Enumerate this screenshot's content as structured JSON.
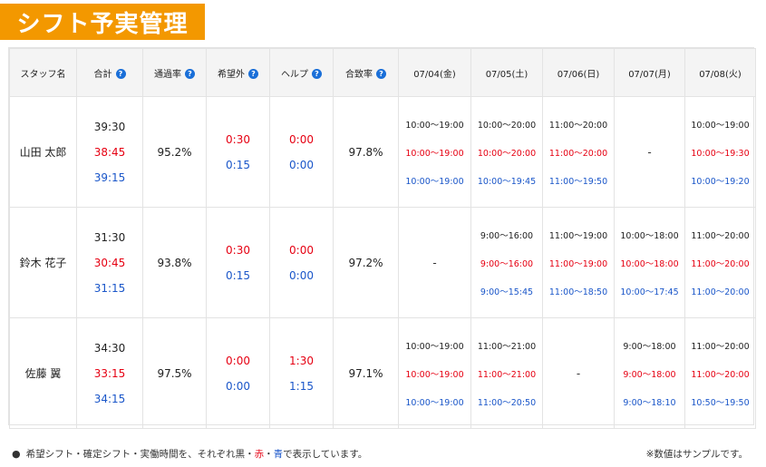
{
  "title": "シフト予実管理",
  "headers": {
    "staff": "スタッフ名",
    "total": "合計",
    "pass_rate": "通過率",
    "unwanted": "希望外",
    "help": "ヘルプ",
    "match_rate": "合致率",
    "dates": [
      "07/04(金)",
      "07/05(土)",
      "07/06(日)",
      "07/07(月)",
      "07/08(火)"
    ],
    "help_mark": "?"
  },
  "rows": [
    {
      "name": "山田 太郎",
      "total": [
        "39:30",
        "38:45",
        "39:15"
      ],
      "pass_rate": "95.2%",
      "unwanted": [
        "0:30",
        "0:15"
      ],
      "help": [
        "0:00",
        "0:00"
      ],
      "match_rate": "97.8%",
      "days": [
        [
          "10:00〜19:00",
          "10:00〜19:00",
          "10:00〜19:00"
        ],
        [
          "10:00〜20:00",
          "10:00〜20:00",
          "10:00〜19:45"
        ],
        [
          "11:00〜20:00",
          "11:00〜20:00",
          "11:00〜19:50"
        ],
        "-",
        [
          "10:00〜19:00",
          "10:00〜19:30",
          "10:00〜19:20"
        ]
      ]
    },
    {
      "name": "鈴木 花子",
      "total": [
        "31:30",
        "30:45",
        "31:15"
      ],
      "pass_rate": "93.8%",
      "unwanted": [
        "0:30",
        "0:15"
      ],
      "help": [
        "0:00",
        "0:00"
      ],
      "match_rate": "97.2%",
      "days": [
        "-",
        [
          "9:00〜16:00",
          "9:00〜16:00",
          "9:00〜15:45"
        ],
        [
          "11:00〜19:00",
          "11:00〜19:00",
          "11:00〜18:50"
        ],
        [
          "10:00〜18:00",
          "10:00〜18:00",
          "10:00〜17:45"
        ],
        [
          "11:00〜20:00",
          "11:00〜20:00",
          "11:00〜20:00"
        ]
      ]
    },
    {
      "name": "佐藤 翼",
      "total": [
        "34:30",
        "33:15",
        "34:15"
      ],
      "pass_rate": "97.5%",
      "unwanted": [
        "0:00",
        "0:00"
      ],
      "help": [
        "1:30",
        "1:15"
      ],
      "match_rate": "97.1%",
      "days": [
        [
          "10:00〜19:00",
          "10:00〜19:00",
          "10:00〜19:00"
        ],
        [
          "11:00〜21:00",
          "11:00〜21:00",
          "11:00〜20:50"
        ],
        "-",
        [
          "9:00〜18:00",
          "9:00〜18:00",
          "9:00〜18:10"
        ],
        [
          "11:00〜20:00",
          "11:00〜20:00",
          "10:50〜19:50"
        ]
      ]
    }
  ],
  "footer": {
    "bullet": "●",
    "note_prefix": "希望シフト・確定シフト・実働時間を、それぞれ黒・",
    "note_red": "赤",
    "note_sep": "・",
    "note_blue": "青",
    "note_suffix": "で表示しています。",
    "sample": "※数値はサンプルです。"
  },
  "colors": {
    "accent": "#f39800",
    "planned": "#222222",
    "confirmed": "#e60012",
    "actual": "#1a56c9",
    "help_icon": "#1a6fd8"
  }
}
